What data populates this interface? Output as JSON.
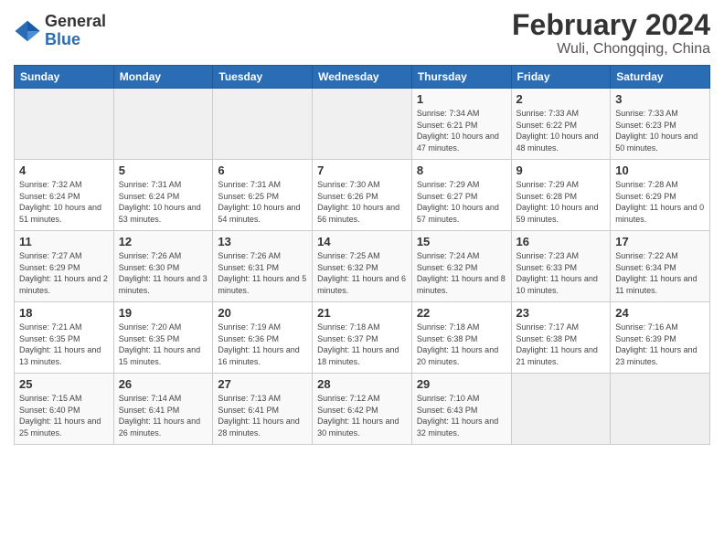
{
  "header": {
    "logo_general": "General",
    "logo_blue": "Blue",
    "title": "February 2024",
    "subtitle": "Wuli, Chongqing, China"
  },
  "weekdays": [
    "Sunday",
    "Monday",
    "Tuesday",
    "Wednesday",
    "Thursday",
    "Friday",
    "Saturday"
  ],
  "weeks": [
    [
      {
        "day": "",
        "info": ""
      },
      {
        "day": "",
        "info": ""
      },
      {
        "day": "",
        "info": ""
      },
      {
        "day": "",
        "info": ""
      },
      {
        "day": "1",
        "info": "Sunrise: 7:34 AM\nSunset: 6:21 PM\nDaylight: 10 hours and 47 minutes."
      },
      {
        "day": "2",
        "info": "Sunrise: 7:33 AM\nSunset: 6:22 PM\nDaylight: 10 hours and 48 minutes."
      },
      {
        "day": "3",
        "info": "Sunrise: 7:33 AM\nSunset: 6:23 PM\nDaylight: 10 hours and 50 minutes."
      }
    ],
    [
      {
        "day": "4",
        "info": "Sunrise: 7:32 AM\nSunset: 6:24 PM\nDaylight: 10 hours and 51 minutes."
      },
      {
        "day": "5",
        "info": "Sunrise: 7:31 AM\nSunset: 6:24 PM\nDaylight: 10 hours and 53 minutes."
      },
      {
        "day": "6",
        "info": "Sunrise: 7:31 AM\nSunset: 6:25 PM\nDaylight: 10 hours and 54 minutes."
      },
      {
        "day": "7",
        "info": "Sunrise: 7:30 AM\nSunset: 6:26 PM\nDaylight: 10 hours and 56 minutes."
      },
      {
        "day": "8",
        "info": "Sunrise: 7:29 AM\nSunset: 6:27 PM\nDaylight: 10 hours and 57 minutes."
      },
      {
        "day": "9",
        "info": "Sunrise: 7:29 AM\nSunset: 6:28 PM\nDaylight: 10 hours and 59 minutes."
      },
      {
        "day": "10",
        "info": "Sunrise: 7:28 AM\nSunset: 6:29 PM\nDaylight: 11 hours and 0 minutes."
      }
    ],
    [
      {
        "day": "11",
        "info": "Sunrise: 7:27 AM\nSunset: 6:29 PM\nDaylight: 11 hours and 2 minutes."
      },
      {
        "day": "12",
        "info": "Sunrise: 7:26 AM\nSunset: 6:30 PM\nDaylight: 11 hours and 3 minutes."
      },
      {
        "day": "13",
        "info": "Sunrise: 7:26 AM\nSunset: 6:31 PM\nDaylight: 11 hours and 5 minutes."
      },
      {
        "day": "14",
        "info": "Sunrise: 7:25 AM\nSunset: 6:32 PM\nDaylight: 11 hours and 6 minutes."
      },
      {
        "day": "15",
        "info": "Sunrise: 7:24 AM\nSunset: 6:32 PM\nDaylight: 11 hours and 8 minutes."
      },
      {
        "day": "16",
        "info": "Sunrise: 7:23 AM\nSunset: 6:33 PM\nDaylight: 11 hours and 10 minutes."
      },
      {
        "day": "17",
        "info": "Sunrise: 7:22 AM\nSunset: 6:34 PM\nDaylight: 11 hours and 11 minutes."
      }
    ],
    [
      {
        "day": "18",
        "info": "Sunrise: 7:21 AM\nSunset: 6:35 PM\nDaylight: 11 hours and 13 minutes."
      },
      {
        "day": "19",
        "info": "Sunrise: 7:20 AM\nSunset: 6:35 PM\nDaylight: 11 hours and 15 minutes."
      },
      {
        "day": "20",
        "info": "Sunrise: 7:19 AM\nSunset: 6:36 PM\nDaylight: 11 hours and 16 minutes."
      },
      {
        "day": "21",
        "info": "Sunrise: 7:18 AM\nSunset: 6:37 PM\nDaylight: 11 hours and 18 minutes."
      },
      {
        "day": "22",
        "info": "Sunrise: 7:18 AM\nSunset: 6:38 PM\nDaylight: 11 hours and 20 minutes."
      },
      {
        "day": "23",
        "info": "Sunrise: 7:17 AM\nSunset: 6:38 PM\nDaylight: 11 hours and 21 minutes."
      },
      {
        "day": "24",
        "info": "Sunrise: 7:16 AM\nSunset: 6:39 PM\nDaylight: 11 hours and 23 minutes."
      }
    ],
    [
      {
        "day": "25",
        "info": "Sunrise: 7:15 AM\nSunset: 6:40 PM\nDaylight: 11 hours and 25 minutes."
      },
      {
        "day": "26",
        "info": "Sunrise: 7:14 AM\nSunset: 6:41 PM\nDaylight: 11 hours and 26 minutes."
      },
      {
        "day": "27",
        "info": "Sunrise: 7:13 AM\nSunset: 6:41 PM\nDaylight: 11 hours and 28 minutes."
      },
      {
        "day": "28",
        "info": "Sunrise: 7:12 AM\nSunset: 6:42 PM\nDaylight: 11 hours and 30 minutes."
      },
      {
        "day": "29",
        "info": "Sunrise: 7:10 AM\nSunset: 6:43 PM\nDaylight: 11 hours and 32 minutes."
      },
      {
        "day": "",
        "info": ""
      },
      {
        "day": "",
        "info": ""
      }
    ]
  ]
}
